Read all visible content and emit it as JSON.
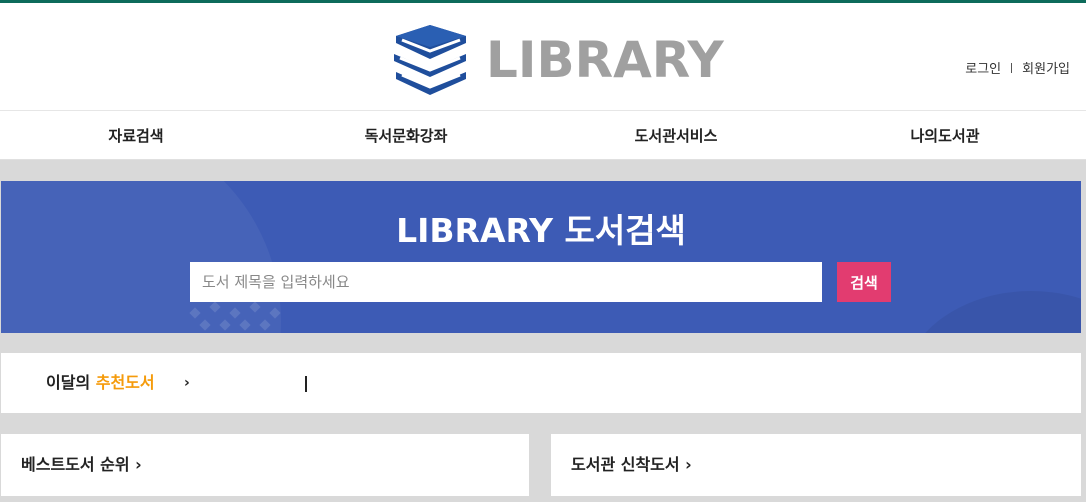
{
  "header": {
    "logo_text": "LIBRARY",
    "auth": {
      "login": "로그인",
      "signup": "회원가입"
    }
  },
  "nav": {
    "items": [
      {
        "label": "자료검색"
      },
      {
        "label": "독서문화강좌"
      },
      {
        "label": "도서관서비스"
      },
      {
        "label": "나의도서관"
      }
    ]
  },
  "search": {
    "title": "LIBRARY 도서검색",
    "placeholder": "도서 제목을 입력하세요",
    "button_label": "검색"
  },
  "recommend": {
    "label_prefix": "이달의 ",
    "label_highlight": "추천도서",
    "arrow": "›"
  },
  "panels": {
    "best": {
      "title": "베스트도서 순위 ›"
    },
    "new": {
      "title": "도서관 신착도서 ›"
    }
  },
  "colors": {
    "brand_blue": "#3d5bb5",
    "logo_blue": "#1f4e9c",
    "accent_pink": "#e23c70",
    "highlight_orange": "#f59b0b",
    "top_line": "#0d6b5b"
  },
  "icons": {
    "logo": "books-stack-icon"
  }
}
